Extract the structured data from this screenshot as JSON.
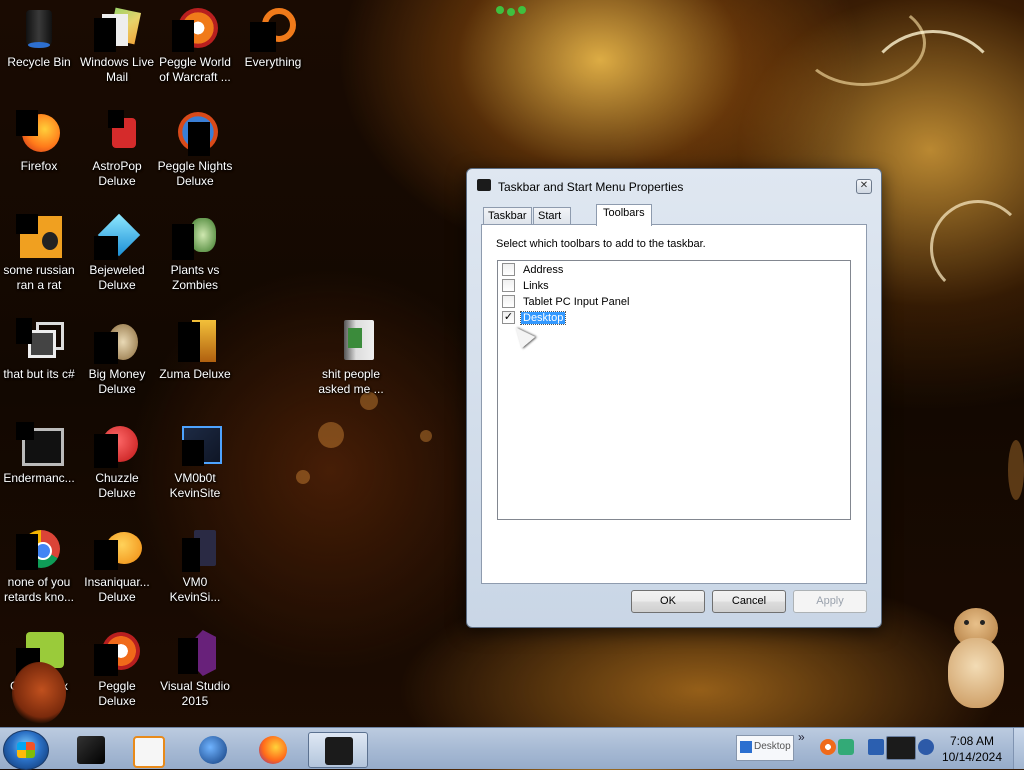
{
  "desktop": {
    "icons": [
      {
        "label": "Recycle Bin",
        "icon": "recycle-bin-icon"
      },
      {
        "label": "Windows Live Mail",
        "icon": "mail-icon"
      },
      {
        "label": "Peggle World of Warcraft ...",
        "icon": "peggle-icon"
      },
      {
        "label": "Everything",
        "icon": "everything-search-icon"
      },
      {
        "label": "Firefox",
        "icon": "firefox-icon"
      },
      {
        "label": "AstroPop Deluxe",
        "icon": "astropop-icon"
      },
      {
        "label": "Peggle Nights Deluxe",
        "icon": "peggle-icon"
      },
      {
        "label": "some russian ran a rat",
        "icon": "app-icon"
      },
      {
        "label": "Bejeweled Deluxe",
        "icon": "bejeweled-icon"
      },
      {
        "label": "Plants vs Zombies",
        "icon": "plants-vs-zombies-icon"
      },
      {
        "label": "that but its c#",
        "icon": "shortcut-icon"
      },
      {
        "label": "Big Money Deluxe",
        "icon": "big-money-icon"
      },
      {
        "label": "Zuma Deluxe",
        "icon": "zuma-icon"
      },
      {
        "label": "shit people asked me ...",
        "icon": "folder-icon"
      },
      {
        "label": "Endermanc...",
        "icon": "terminal-icon"
      },
      {
        "label": "Chuzzle Deluxe",
        "icon": "chuzzle-icon"
      },
      {
        "label": "VM0b0t KevinSite",
        "icon": "vm-icon"
      },
      {
        "label": "none of you retards kno...",
        "icon": "chrome-icon"
      },
      {
        "label": "Insaniquar... Deluxe",
        "icon": "insaniquarium-icon"
      },
      {
        "label": "VM0 KevinSi...",
        "icon": "file-icon"
      },
      {
        "label": "Ch",
        "icon": "game-icon"
      },
      {
        "label": "ox",
        "icon": "game-icon"
      },
      {
        "label": "Peggle Deluxe",
        "icon": "peggle-icon"
      },
      {
        "label": "Visual Studio 2015",
        "icon": "visual-studio-icon"
      }
    ]
  },
  "dialog": {
    "title": "Taskbar and Start Menu Properties",
    "close_glyph": "✕",
    "tabs": [
      {
        "label": "Taskbar",
        "active": false
      },
      {
        "label": "Start Menu",
        "active": false
      },
      {
        "label": "Toolbars",
        "active": true
      }
    ],
    "instruction": "Select which toolbars to add to the taskbar.",
    "toolbars": [
      {
        "label": "Address",
        "checked": false
      },
      {
        "label": "Links",
        "checked": false
      },
      {
        "label": "Tablet PC Input Panel",
        "checked": false
      },
      {
        "label": "Desktop",
        "checked": true,
        "selected": true
      }
    ],
    "buttons": {
      "ok": "OK",
      "cancel": "Cancel",
      "apply": "Apply"
    }
  },
  "taskbar": {
    "pinned": [
      "terminal-icon",
      "media-player-icon",
      "globe-icon",
      "firefox-icon",
      "properties-window-icon"
    ],
    "tray": {
      "toolbar_label": "Desktop",
      "chevron": "»"
    },
    "clock": {
      "time": "7:08 AM",
      "date": "10/14/2024"
    }
  },
  "colors": {
    "selection": "#3399ff",
    "taskbar": "#a7bad4"
  }
}
